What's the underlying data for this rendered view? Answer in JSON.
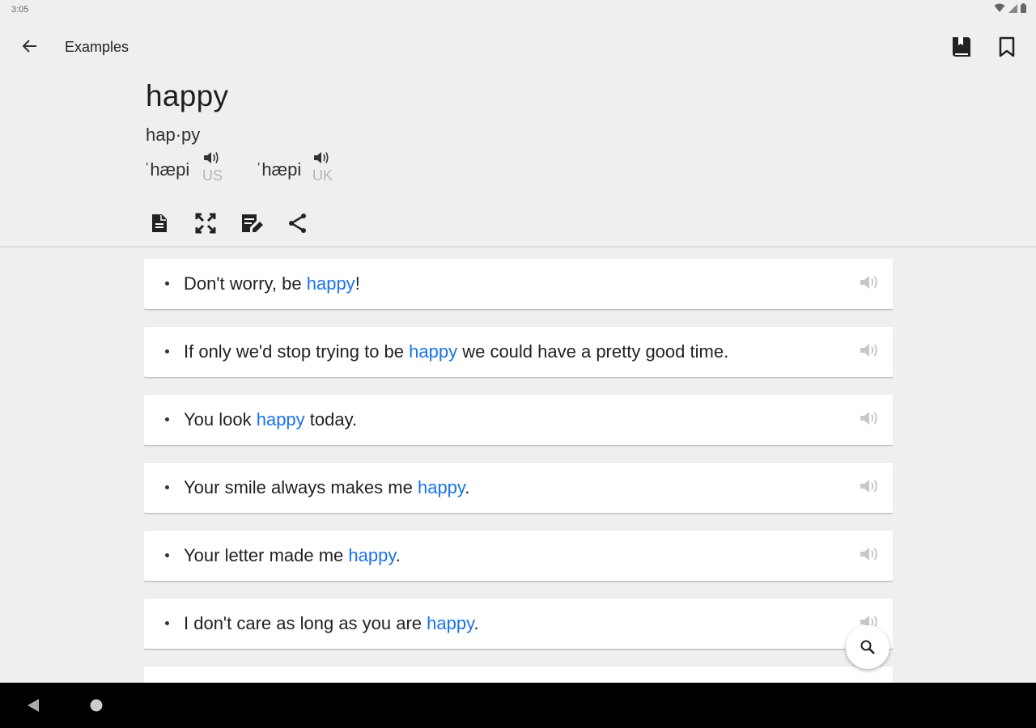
{
  "status_bar": {
    "time": "3:05"
  },
  "app_bar": {
    "title": "Examples",
    "back_icon": "arrow-back-icon",
    "dictionary_icon": "dictionary-book-icon",
    "bookmark_icon": "bookmark-icon"
  },
  "entry": {
    "word": "happy",
    "syllables": "hap·py",
    "pronunciations": [
      {
        "ipa": "ˈhæpi",
        "region": "US"
      },
      {
        "ipa": "ˈhæpi",
        "region": "UK"
      }
    ]
  },
  "toolbar": {
    "icons": [
      "document-icon",
      "fullscreen-icon",
      "edit-note-icon",
      "share-icon"
    ]
  },
  "examples": [
    {
      "before": "Don't worry, be ",
      "highlight": "happy",
      "after": "!"
    },
    {
      "before": "If only we'd stop trying to be ",
      "highlight": "happy",
      "after": " we could have a pretty good time."
    },
    {
      "before": "You look ",
      "highlight": "happy",
      "after": " today."
    },
    {
      "before": "Your smile always makes me ",
      "highlight": "happy",
      "after": "."
    },
    {
      "before": "Your letter made me ",
      "highlight": "happy",
      "after": "."
    },
    {
      "before": "I don't care as long as you are ",
      "highlight": "happy",
      "after": "."
    }
  ],
  "fab": {
    "icon": "search-icon"
  },
  "colors": {
    "highlight": "#1a73e8",
    "background": "#efefef",
    "card": "#ffffff"
  }
}
